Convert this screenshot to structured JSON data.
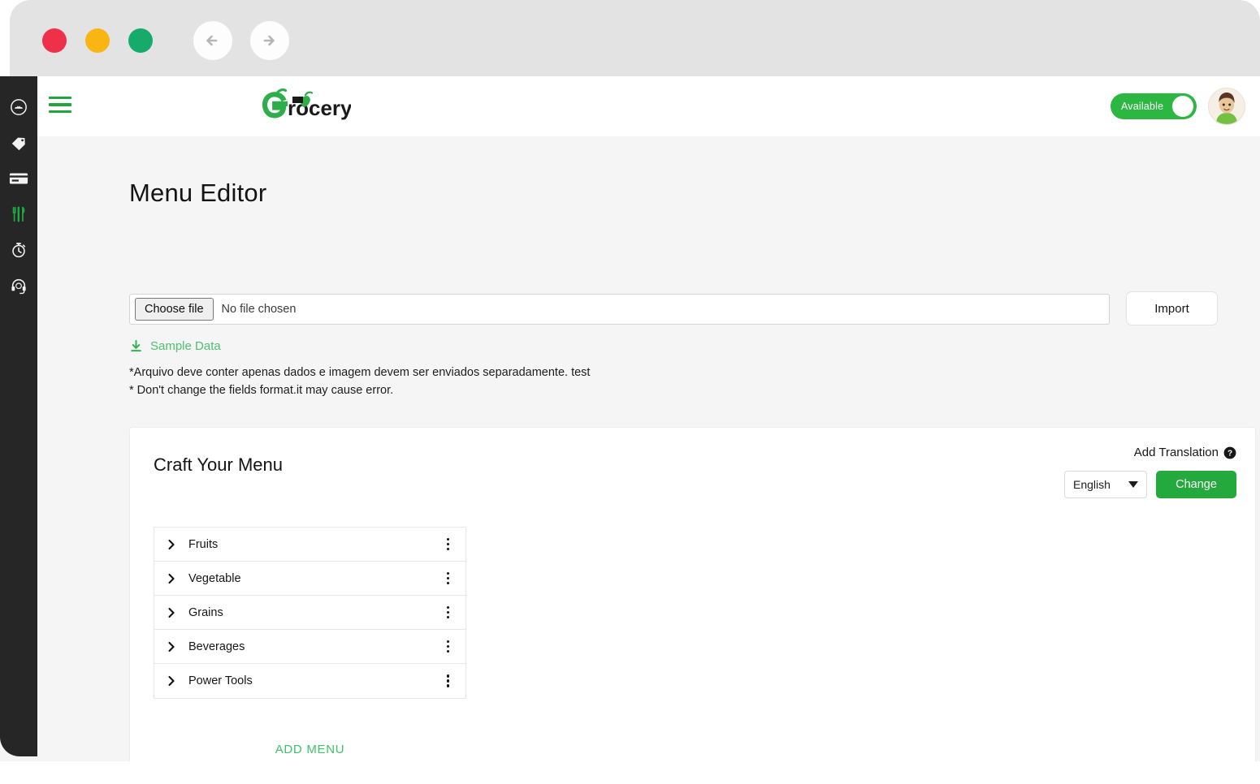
{
  "browser": {
    "traffic_lights": [
      {
        "name": "close",
        "color": "#ee3048"
      },
      {
        "name": "minimize",
        "color": "#f9b513"
      },
      {
        "name": "maximize",
        "color": "#17ab6b"
      }
    ],
    "back_label": "Back",
    "forward_label": "Forward"
  },
  "sidebar": {
    "items": [
      {
        "icon": "dashboard-icon",
        "active": false
      },
      {
        "icon": "tag-icon",
        "active": false
      },
      {
        "icon": "card-icon",
        "active": false
      },
      {
        "icon": "cutlery-icon",
        "active": true
      },
      {
        "icon": "timer-icon",
        "active": false
      },
      {
        "icon": "headset-icon",
        "active": false
      }
    ],
    "active_color": "#21a63f"
  },
  "topbar": {
    "menu_icon": "hamburger-icon",
    "brand_name": "Grocery",
    "brand_color": "#2eae4a",
    "availability": {
      "label": "Available",
      "on": true,
      "color": "#2cb742"
    },
    "avatar_alt": "User avatar"
  },
  "main": {
    "page_title": "Menu Editor",
    "upload": {
      "choose_file_label": "Choose file",
      "file_name": "No file chosen",
      "import_label": "Import"
    },
    "sample_data": {
      "label": "Sample Data",
      "icon": "download-icon",
      "color": "#4bc171"
    },
    "notes": [
      "*Arquivo deve conter apenas dados e imagem devem ser enviados separadamente. test",
      "* Don't change the fields format.it may cause error."
    ]
  },
  "card": {
    "title": "Craft Your Menu",
    "translation": {
      "label": "Add Translation",
      "help_icon": "help-icon",
      "selected_language": "English",
      "change_label": "Change",
      "change_color": "#23a93c"
    },
    "menu_items": [
      {
        "name": "Fruits"
      },
      {
        "name": "Vegetable"
      },
      {
        "name": "Grains"
      },
      {
        "name": "Beverages"
      },
      {
        "name": "Power Tools"
      }
    ],
    "add_menu_label": "ADD MENU",
    "add_menu_color": "#3fc06b"
  }
}
